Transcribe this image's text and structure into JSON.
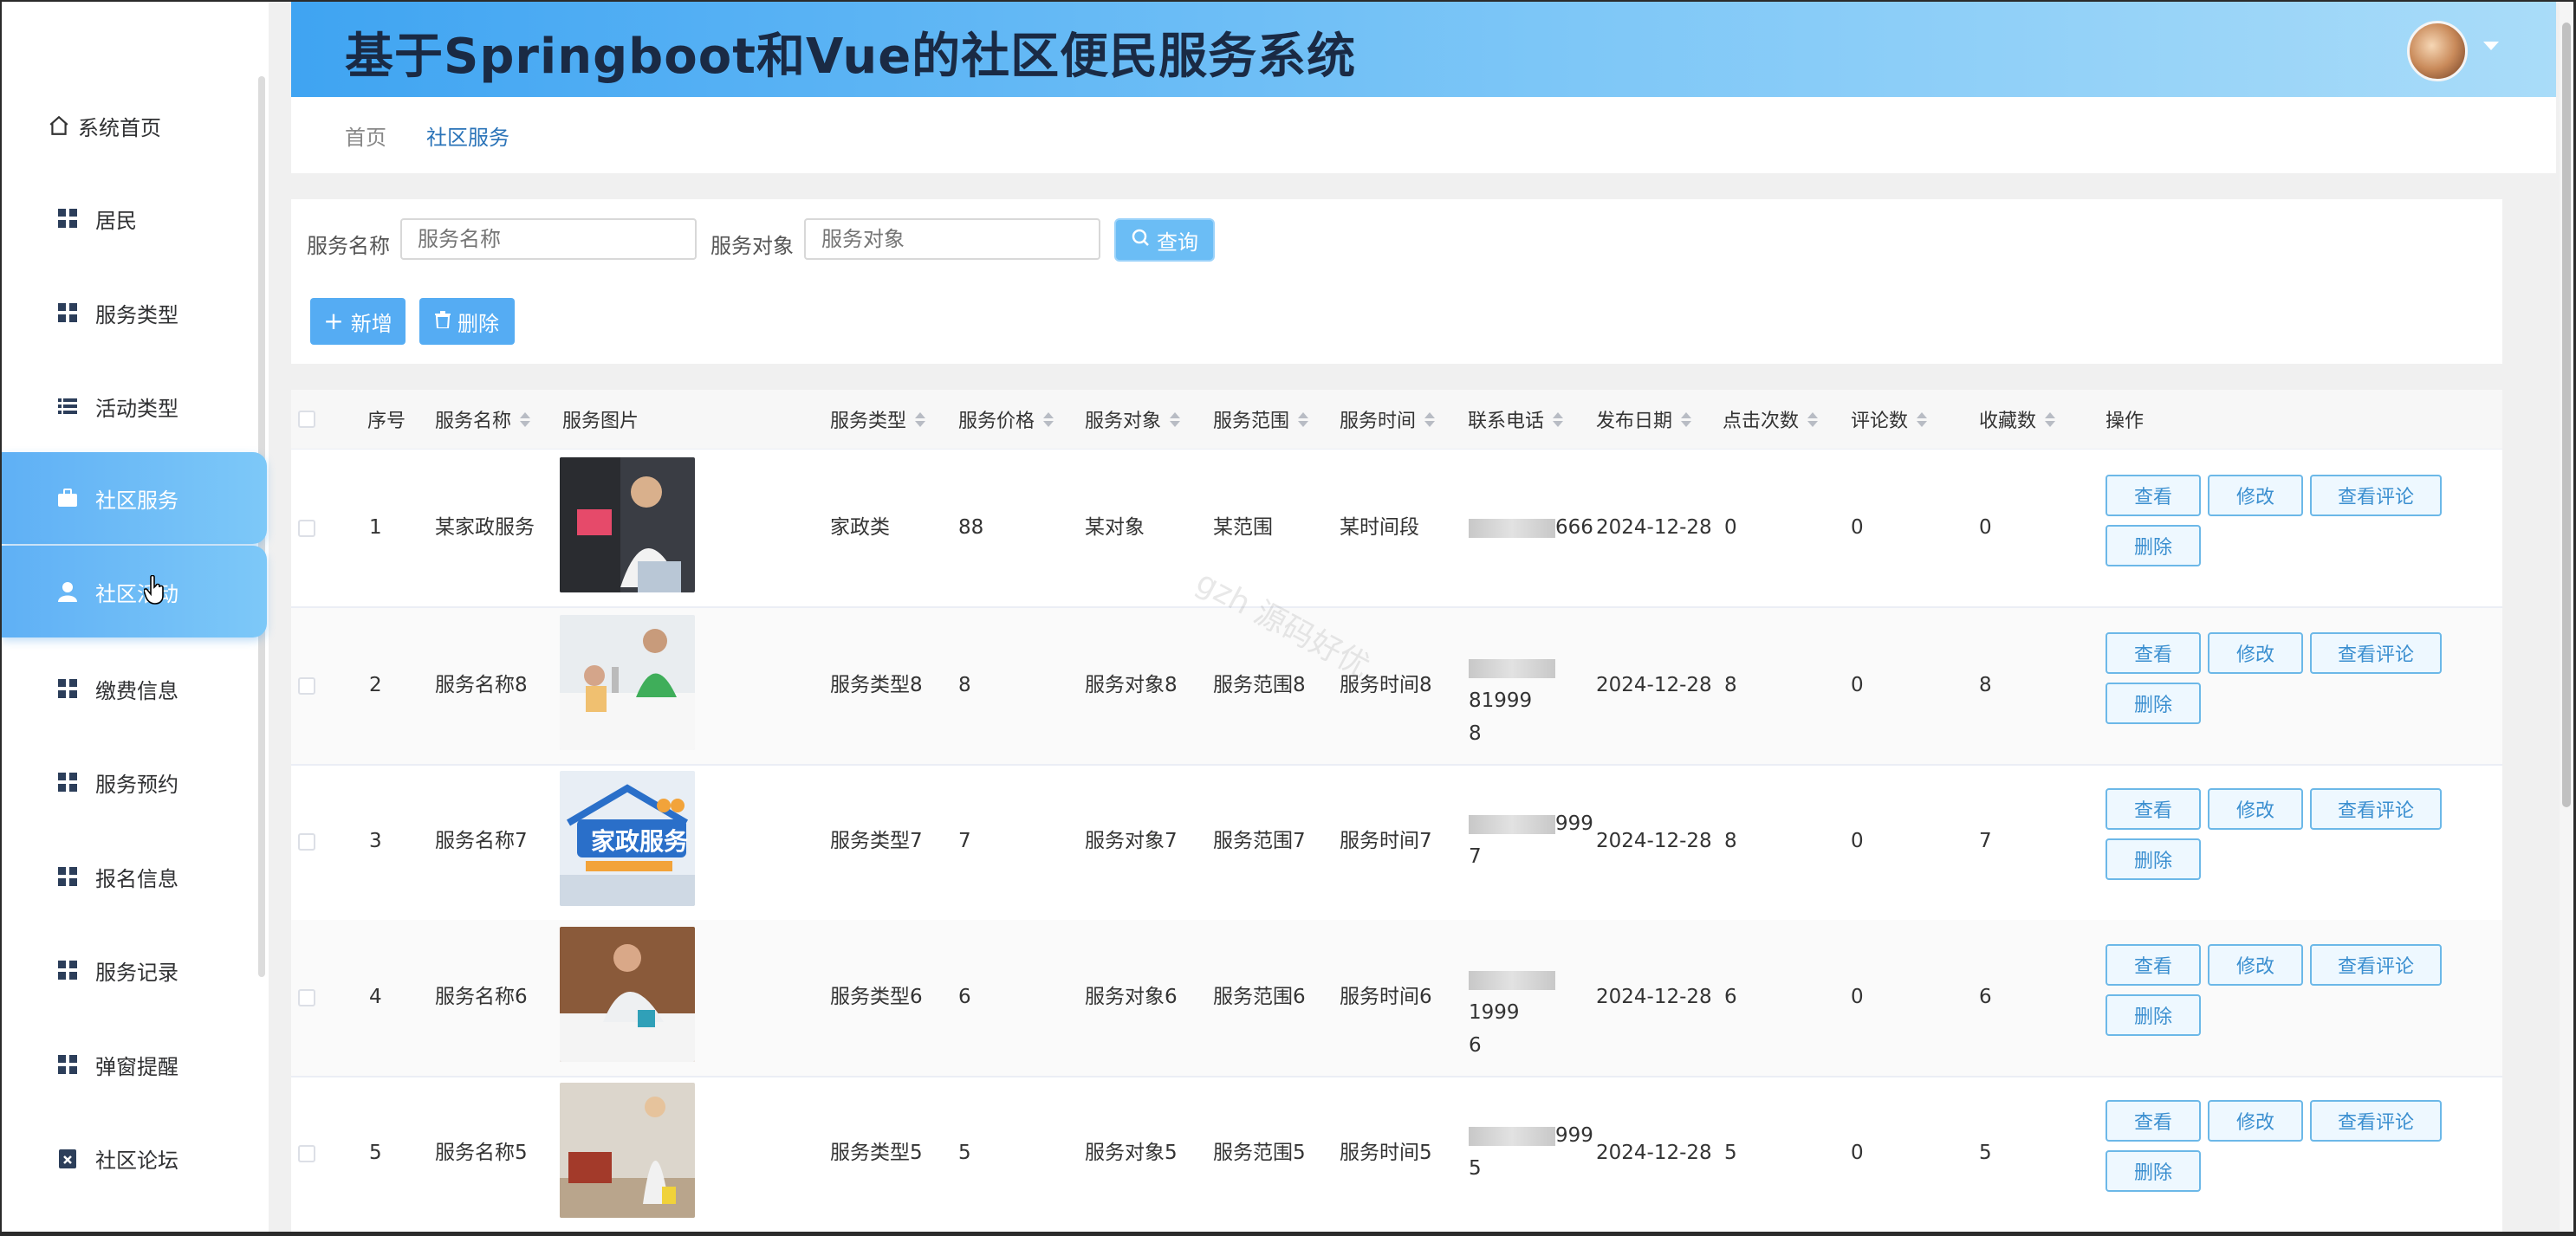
{
  "header": {
    "title": "基于Springboot和Vue的社区便民服务系统"
  },
  "breadcrumb": [
    "首页",
    "社区服务"
  ],
  "sidebar": {
    "items": [
      {
        "label": "系统首页",
        "icon": "home-icon"
      },
      {
        "label": "居民",
        "icon": "grid-icon"
      },
      {
        "label": "服务类型",
        "icon": "grid-icon"
      },
      {
        "label": "活动类型",
        "icon": "list-icon"
      },
      {
        "label": "社区服务",
        "icon": "briefcase-icon",
        "active": true
      },
      {
        "label": "社区活动",
        "icon": "user-icon",
        "active": true
      },
      {
        "label": "缴费信息",
        "icon": "grid-icon"
      },
      {
        "label": "服务预约",
        "icon": "grid-icon"
      },
      {
        "label": "报名信息",
        "icon": "grid-icon"
      },
      {
        "label": "服务记录",
        "icon": "grid-icon"
      },
      {
        "label": "弹窗提醒",
        "icon": "grid-icon"
      },
      {
        "label": "社区论坛",
        "icon": "clipboard-icon"
      }
    ]
  },
  "search": {
    "name_label": "服务名称",
    "name_placeholder": "服务名称",
    "target_label": "服务对象",
    "target_placeholder": "服务对象",
    "query_label": "查询"
  },
  "actions": {
    "add_label": "新增",
    "delete_label": "删除"
  },
  "table": {
    "columns": [
      "序号",
      "服务名称",
      "服务图片",
      "服务类型",
      "服务价格",
      "服务对象",
      "服务范围",
      "服务时间",
      "联系电话",
      "发布日期",
      "点击次数",
      "评论数",
      "收藏数",
      "操作"
    ],
    "row_buttons": [
      "查看",
      "修改",
      "查看评论",
      "删除"
    ],
    "rows": [
      {
        "index": "1",
        "name": "某家政服务",
        "type": "家政类",
        "price": "88",
        "target": "某对象",
        "scope": "某范围",
        "time": "某时间段",
        "phone_a": "666",
        "phone_b": "",
        "date": "2024-12-28",
        "clicks": "0",
        "comments": "0",
        "favorites": "0"
      },
      {
        "index": "2",
        "name": "服务名称8",
        "type": "服务类型8",
        "price": "8",
        "target": "服务对象8",
        "scope": "服务范围8",
        "time": "服务时间8",
        "phone_a": "81999",
        "phone_b": "8",
        "date": "2024-12-28",
        "clicks": "8",
        "comments": "0",
        "favorites": "8"
      },
      {
        "index": "3",
        "name": "服务名称7",
        "type": "服务类型7",
        "price": "7",
        "target": "服务对象7",
        "scope": "服务范围7",
        "time": "服务时间7",
        "phone_a": "999",
        "phone_b": "7",
        "date": "2024-12-28",
        "clicks": "8",
        "comments": "0",
        "favorites": "7"
      },
      {
        "index": "4",
        "name": "服务名称6",
        "type": "服务类型6",
        "price": "6",
        "target": "服务对象6",
        "scope": "服务范围6",
        "time": "服务时间6",
        "phone_a": "1999",
        "phone_b": "6",
        "date": "2024-12-28",
        "clicks": "6",
        "comments": "0",
        "favorites": "6"
      },
      {
        "index": "5",
        "name": "服务名称5",
        "type": "服务类型5",
        "price": "5",
        "target": "服务对象5",
        "scope": "服务范围5",
        "time": "服务时间5",
        "phone_a": "999",
        "phone_b": "5",
        "date": "2024-12-28",
        "clicks": "5",
        "comments": "0",
        "favorites": "5"
      }
    ]
  },
  "watermark": "gzh 源码好优",
  "colors": {
    "accent": "#55acf3",
    "header_start": "#3fa4f2",
    "link": "#2a73b8"
  }
}
